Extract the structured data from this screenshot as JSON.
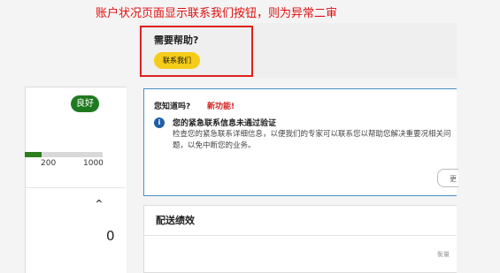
{
  "annotation": "账户状况页面显示联系我们按钮，则为异常二审",
  "left_panel": {
    "rating_badge": "良好",
    "progress_fraction": 0.22,
    "ticks": [
      "200",
      "1000"
    ],
    "collapse_icon": "chevron-up-icon",
    "value": "0"
  },
  "help": {
    "title": "需要帮助?",
    "contact_button": "联系我们"
  },
  "info_card": {
    "heading": "您知道吗?",
    "badge": "新功能!",
    "icon": "info-icon",
    "alert_title": "您的紧急联系信息未通过验证",
    "alert_body": "检查您的紧急联系详细信息，以便我们的专家可以联系您以帮助您解决重要况相关问题，以免中断您的业务。",
    "button_partial": "更"
  },
  "delivery": {
    "title": "配送绩效",
    "snippet": "衡量"
  },
  "colors": {
    "annotation": "#e01010",
    "highlight_border": "#e02020",
    "contact_button": "#f5cc1a",
    "rating_badge": "#1f7a1f",
    "info_border": "#4a90c4",
    "new_feature": "#d42020"
  }
}
